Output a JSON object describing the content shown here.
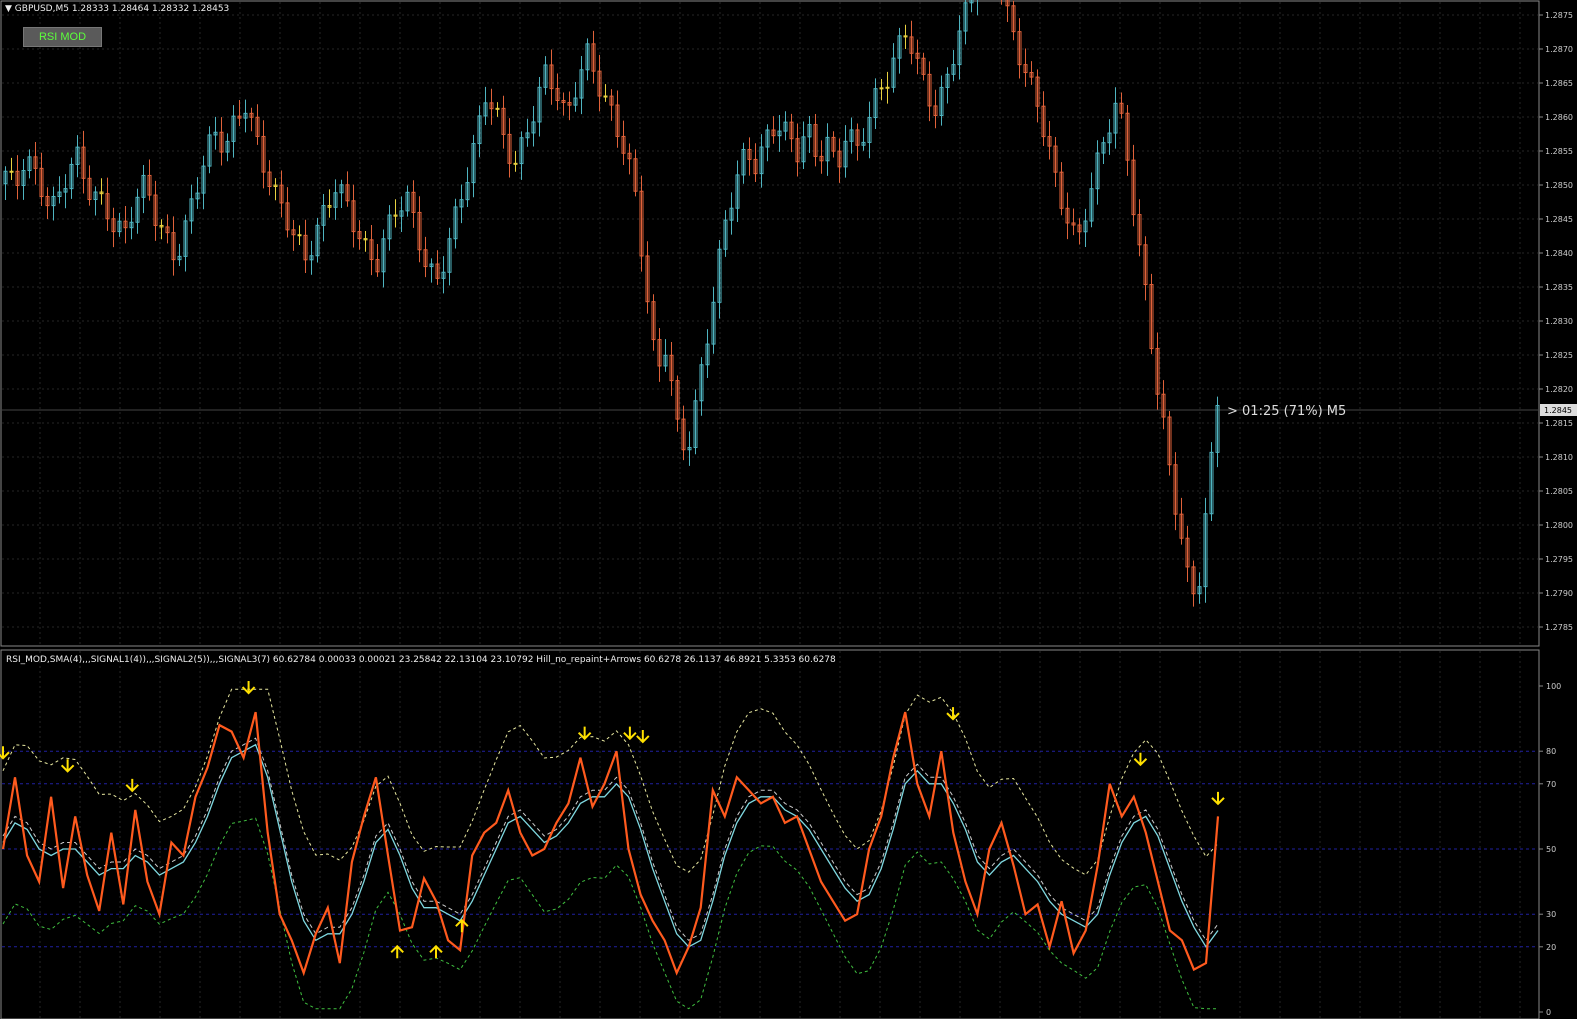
{
  "window": {
    "symbol_info": "GBPUSD,M5  1.28333 1.28464 1.28332 1.28453",
    "button_label": "RSI MOD",
    "timer_label": "> 01:25 (71%) M5",
    "price_marker": "1.2845"
  },
  "indicator": {
    "title": "RSI_MOD,SMA(4),,,SIGNAL1(4)),,,SIGNAL2(5)),,,SIGNAL3(7) 60.62784 0.00033 0.00021 23.25842 22.13104 23.10792   Hill_no_repaint+Arrows 60.6278 26.1137 46.8921 5.3353 60.6278",
    "levels": [
      "100",
      "80",
      "70",
      "50",
      "30",
      "20",
      "0"
    ]
  },
  "price_axis_labels": [
    "1.2875",
    "1.2870",
    "1.2865",
    "1.2860",
    "1.2855",
    "1.2850",
    "1.2845",
    "1.2840",
    "1.2835",
    "1.2830",
    "1.2825",
    "1.2820",
    "1.2815",
    "1.2810",
    "1.2805",
    "1.2800",
    "1.2795",
    "1.2790",
    "1.2785"
  ],
  "colors": {
    "background": "#000000",
    "bull": "#4fb4c0",
    "bear": "#e0623a",
    "doji": "#e8d040",
    "rsi": "#ff5a1e",
    "signal": "#7fd8e0",
    "upper_band": "#e8e8a0",
    "lower_band": "#40c040",
    "arrow": "#ffe000",
    "level_line": "#2020a0"
  },
  "chart_data": {
    "type": "candlestick",
    "symbol": "GBPUSD",
    "timeframe": "M5",
    "last_ohlc": [
      1.28333,
      1.28464,
      1.28332,
      1.28453
    ],
    "close_series": [
      1.2853,
      1.285,
      1.2856,
      1.2852,
      1.2849,
      1.2847,
      1.2852,
      1.2856,
      1.2851,
      1.2849,
      1.2847,
      1.2844,
      1.2843,
      1.2849,
      1.2851,
      1.2846,
      1.2842,
      1.2839,
      1.2844,
      1.285,
      1.2856,
      1.2859,
      1.2857,
      1.2861,
      1.2864,
      1.2858,
      1.2853,
      1.2849,
      1.2846,
      1.2842,
      1.2839,
      1.2843,
      1.2847,
      1.2851,
      1.2848,
      1.2844,
      1.284,
      1.2838,
      1.2843,
      1.2847,
      1.2849,
      1.2844,
      1.2838,
      1.2835,
      1.284,
      1.2846,
      1.2852,
      1.2858,
      1.2866,
      1.2862,
      1.2857,
      1.2854,
      1.2859,
      1.2864,
      1.2869,
      1.2866,
      1.2861,
      1.2867,
      1.2872,
      1.2868,
      1.2864,
      1.286,
      1.2856,
      1.2848,
      1.2834,
      1.282,
      1.2826,
      1.2812,
      1.2808,
      1.2816,
      1.2826,
      1.2836,
      1.2846,
      1.2852,
      1.2856,
      1.2854,
      1.2858,
      1.2861,
      1.2859,
      1.2856,
      1.286,
      1.2855,
      1.2858,
      1.2853,
      1.286,
      1.2856,
      1.2861,
      1.2865,
      1.2868,
      1.2872,
      1.2876,
      1.287,
      1.2866,
      1.2862,
      1.2868,
      1.2874,
      1.2879,
      1.2884,
      1.2888,
      1.2885,
      1.2878,
      1.2873,
      1.2868,
      1.2864,
      1.2858,
      1.285,
      1.2846,
      1.2841,
      1.2848,
      1.2854,
      1.286,
      1.2864,
      1.2856,
      1.2842,
      1.2832,
      1.2818,
      1.2808,
      1.2798,
      1.2788,
      1.2785,
      1.28,
      1.2817
    ],
    "rsi_series": [
      50,
      72,
      48,
      40,
      66,
      38,
      60,
      42,
      31,
      55,
      33,
      62,
      40,
      30,
      52,
      48,
      66,
      75,
      88,
      86,
      78,
      92,
      55,
      30,
      22,
      12,
      24,
      32,
      15,
      46,
      60,
      72,
      48,
      25,
      26,
      41,
      34,
      22,
      19,
      48,
      55,
      58,
      68,
      55,
      48,
      50,
      58,
      64,
      78,
      63,
      70,
      80,
      50,
      36,
      28,
      22,
      12,
      20,
      32,
      68,
      60,
      72,
      68,
      64,
      66,
      58,
      60,
      50,
      40,
      34,
      28,
      30,
      50,
      60,
      78,
      92,
      70,
      60,
      80,
      55,
      40,
      30,
      50,
      58,
      45,
      30,
      33,
      20,
      34,
      18,
      25,
      45,
      70,
      60,
      66,
      55,
      40,
      25,
      22,
      13,
      15,
      60
    ],
    "signal_series": [
      52,
      58,
      56,
      50,
      48,
      50,
      50,
      46,
      42,
      44,
      44,
      48,
      46,
      42,
      44,
      46,
      52,
      60,
      70,
      78,
      80,
      82,
      72,
      56,
      40,
      28,
      22,
      24,
      24,
      30,
      40,
      52,
      56,
      48,
      38,
      32,
      32,
      30,
      28,
      34,
      42,
      50,
      58,
      60,
      56,
      52,
      54,
      58,
      64,
      66,
      66,
      70,
      66,
      56,
      44,
      34,
      24,
      20,
      22,
      34,
      48,
      58,
      64,
      66,
      66,
      62,
      60,
      56,
      50,
      44,
      38,
      34,
      36,
      44,
      56,
      70,
      74,
      70,
      70,
      64,
      56,
      46,
      42,
      46,
      48,
      44,
      40,
      34,
      30,
      28,
      26,
      30,
      42,
      52,
      58,
      60,
      54,
      44,
      34,
      26,
      20,
      25
    ],
    "arrows_down": [
      {
        "i": 0,
        "v": 76
      },
      {
        "i": 10,
        "v": 72
      },
      {
        "i": 20,
        "v": 66
      },
      {
        "i": 38,
        "v": 96
      },
      {
        "i": 90,
        "v": 82
      },
      {
        "i": 97,
        "v": 82
      },
      {
        "i": 99,
        "v": 81
      },
      {
        "i": 147,
        "v": 88
      },
      {
        "i": 176,
        "v": 74
      },
      {
        "i": 188,
        "v": 62
      }
    ],
    "arrows_up": [
      {
        "i": 61,
        "v": 22
      },
      {
        "i": 67,
        "v": 22
      },
      {
        "i": 71,
        "v": 30
      }
    ]
  }
}
